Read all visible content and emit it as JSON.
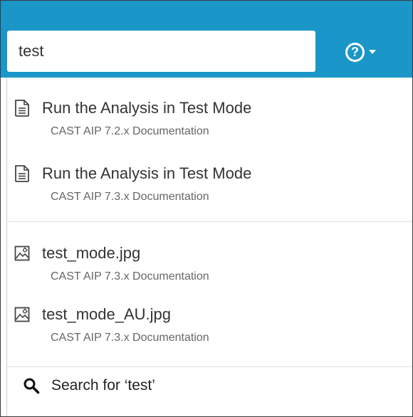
{
  "search": {
    "query": "test"
  },
  "header": {
    "help_icon": "help-circle-icon",
    "help_glyph": "?",
    "accent_color": "#1a96c8"
  },
  "results": [
    {
      "title": "Run the Analysis in Test Mode",
      "space": "CAST AIP 7.2.x Documentation",
      "icon": "page-icon"
    },
    {
      "title": "Run the Analysis in Test Mode",
      "space": "CAST AIP 7.3.x Documentation",
      "icon": "page-icon"
    },
    {
      "title": "test_mode.jpg",
      "space": "CAST AIP 7.3.x Documentation",
      "icon": "image-icon"
    },
    {
      "title": "test_mode_AU.jpg",
      "space": "CAST AIP 7.3.x Documentation",
      "icon": "image-icon"
    }
  ],
  "search_for": {
    "label": "Search for ‘test’",
    "icon": "search-icon"
  }
}
